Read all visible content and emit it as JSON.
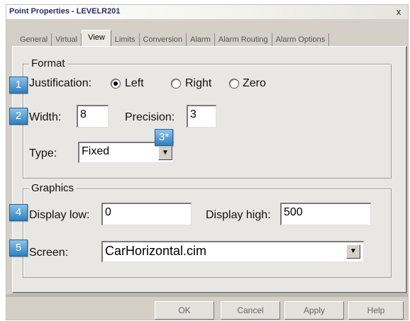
{
  "window": {
    "title": "Point Properties - LEVELR201",
    "close_label": "x"
  },
  "tabs": [
    {
      "label": "General"
    },
    {
      "label": "Virtual"
    },
    {
      "label": "View",
      "active": true
    },
    {
      "label": "Limits"
    },
    {
      "label": "Conversion"
    },
    {
      "label": "Alarm"
    },
    {
      "label": "Alarm Routing"
    },
    {
      "label": "Alarm Options"
    }
  ],
  "format": {
    "legend": "Format",
    "justification_label": "Justification:",
    "options": [
      {
        "label": "Left",
        "checked": true
      },
      {
        "label": "Right",
        "checked": false
      },
      {
        "label": "Zero",
        "checked": false
      }
    ],
    "width_label": "Width:",
    "width_value": "8",
    "precision_label": "Precision:",
    "precision_value": "3",
    "type_label": "Type:",
    "type_value": "Fixed"
  },
  "graphics": {
    "legend": "Graphics",
    "display_low_label": "Display low:",
    "display_low_value": "0",
    "display_high_label": "Display high:",
    "display_high_value": "500",
    "screen_label": "Screen:",
    "screen_value": "CarHorizontal.cim"
  },
  "badges": [
    "1",
    "2",
    "3*",
    "4",
    "5"
  ],
  "buttons": {
    "ok": "OK",
    "cancel": "Cancel",
    "apply": "Apply",
    "help": "Help"
  },
  "colors": {
    "badge": "#2f7fc1",
    "title_text": "#2a2a6a",
    "panel": "#e9e7e3"
  },
  "icons": {
    "dropdown": "chevron-down-icon",
    "close": "close-icon"
  }
}
